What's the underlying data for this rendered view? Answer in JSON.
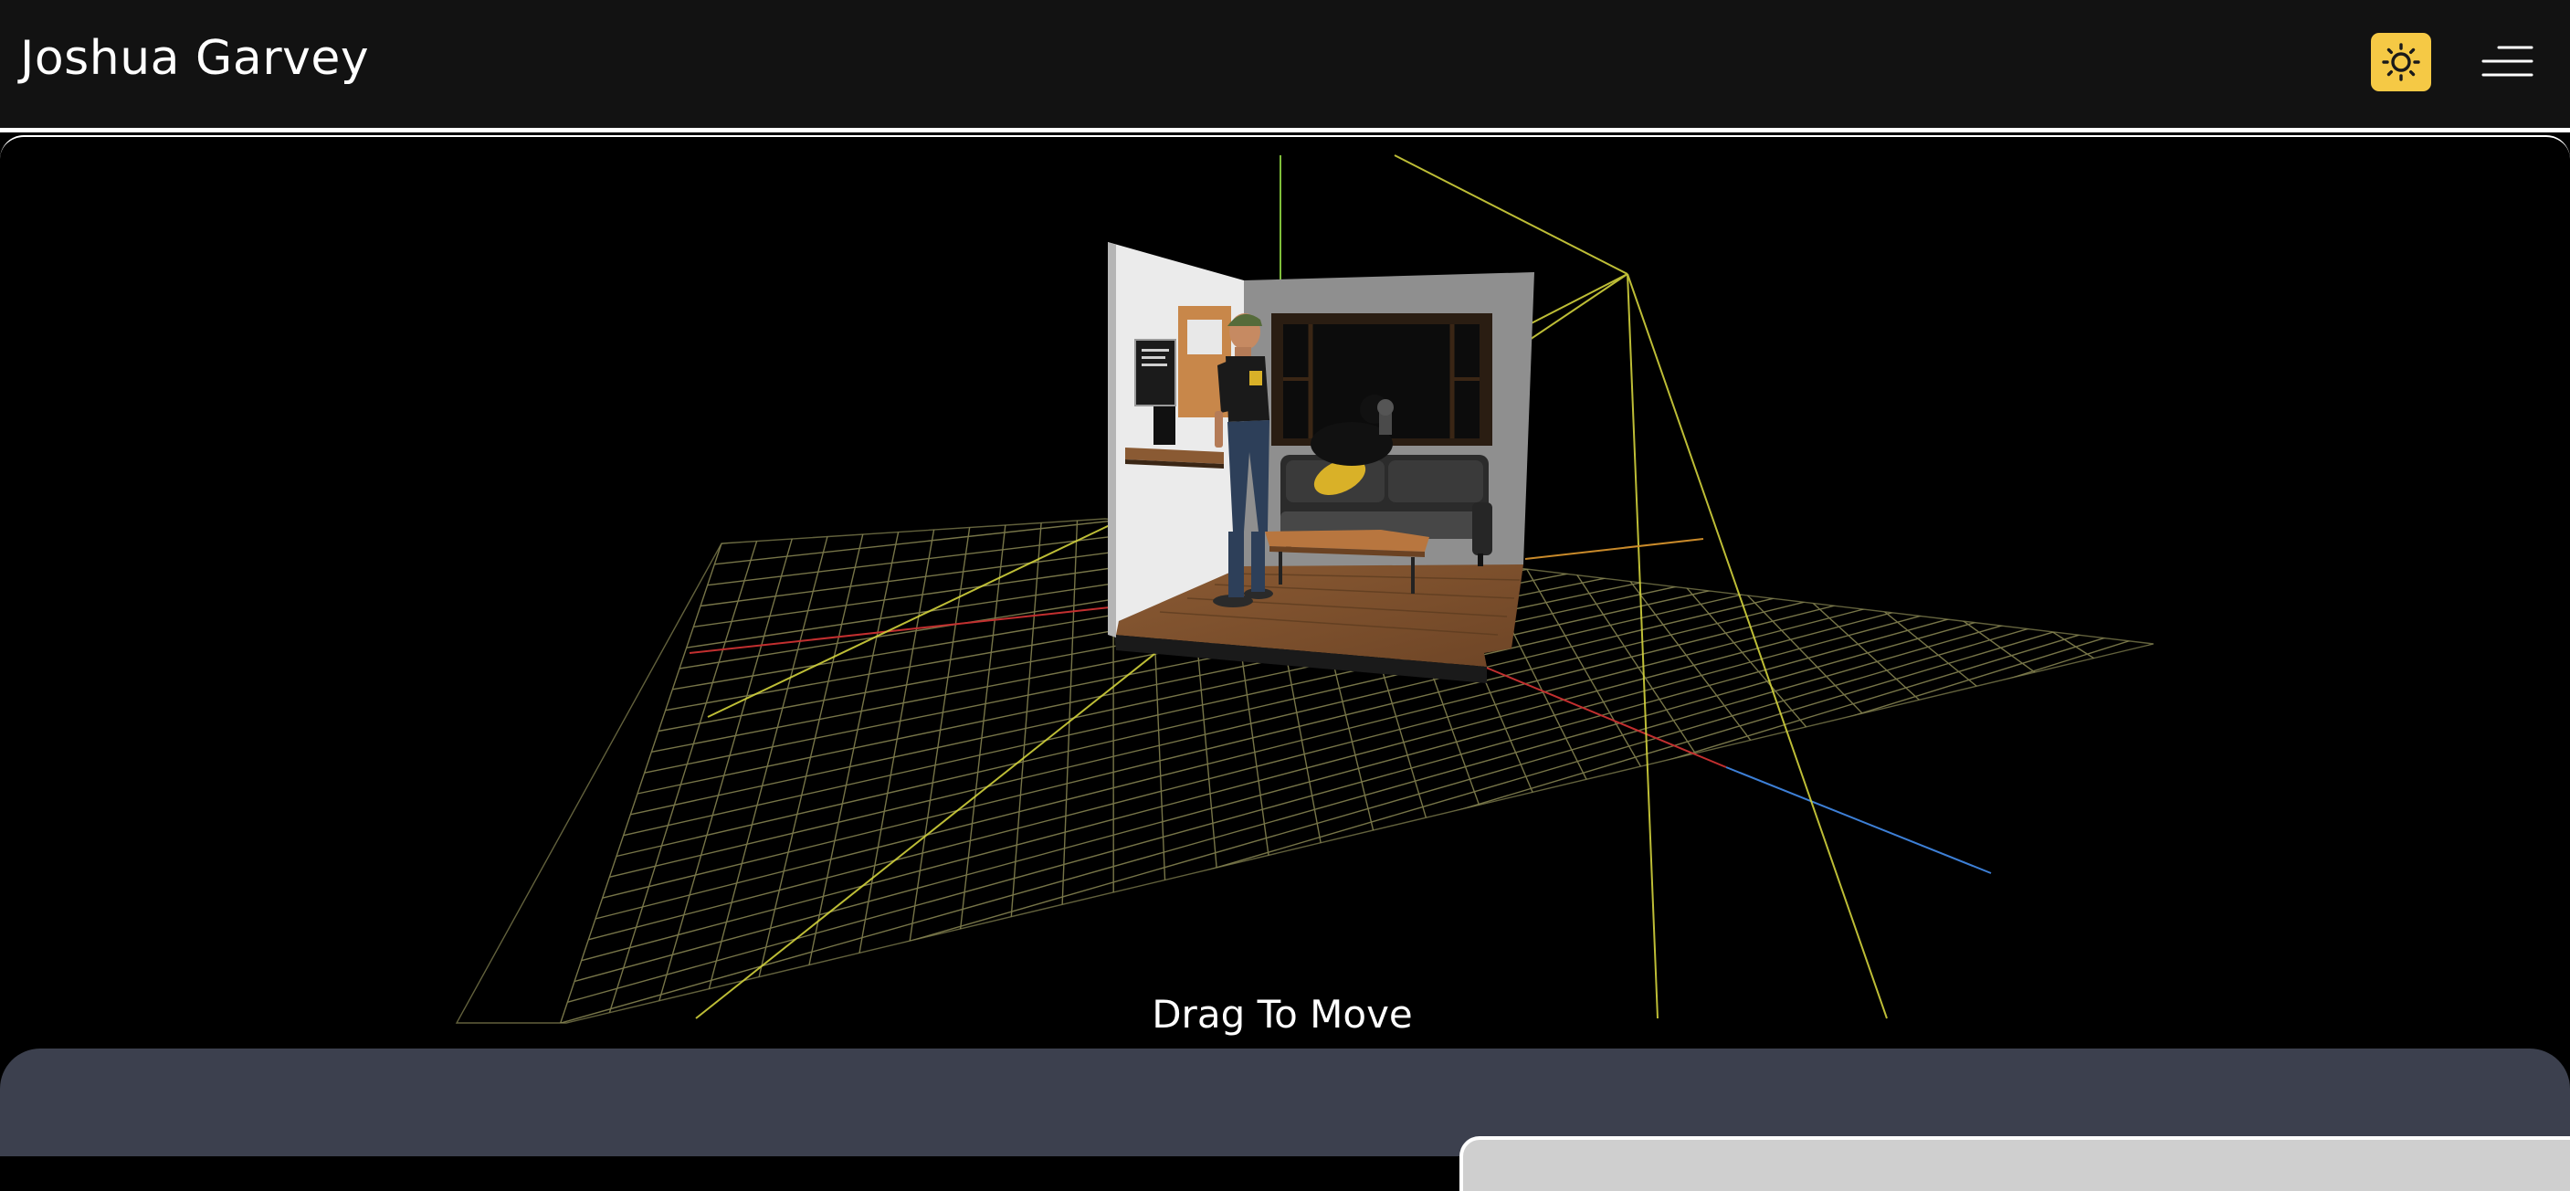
{
  "header": {
    "title": "Joshua Garvey",
    "theme_toggle_icon": "sun-icon",
    "menu_icon": "hamburger-menu-icon"
  },
  "viewer": {
    "hint": "Drag To Move"
  },
  "colors": {
    "header_bg": "#121212",
    "accent_yellow": "#F5C945",
    "scene_bg": "#000000",
    "grid": "#B5B070",
    "axis_x": "#D43030",
    "axis_z": "#3B7DD8",
    "light_helper": "#D6D640",
    "panel_bg": "#3C404E"
  }
}
